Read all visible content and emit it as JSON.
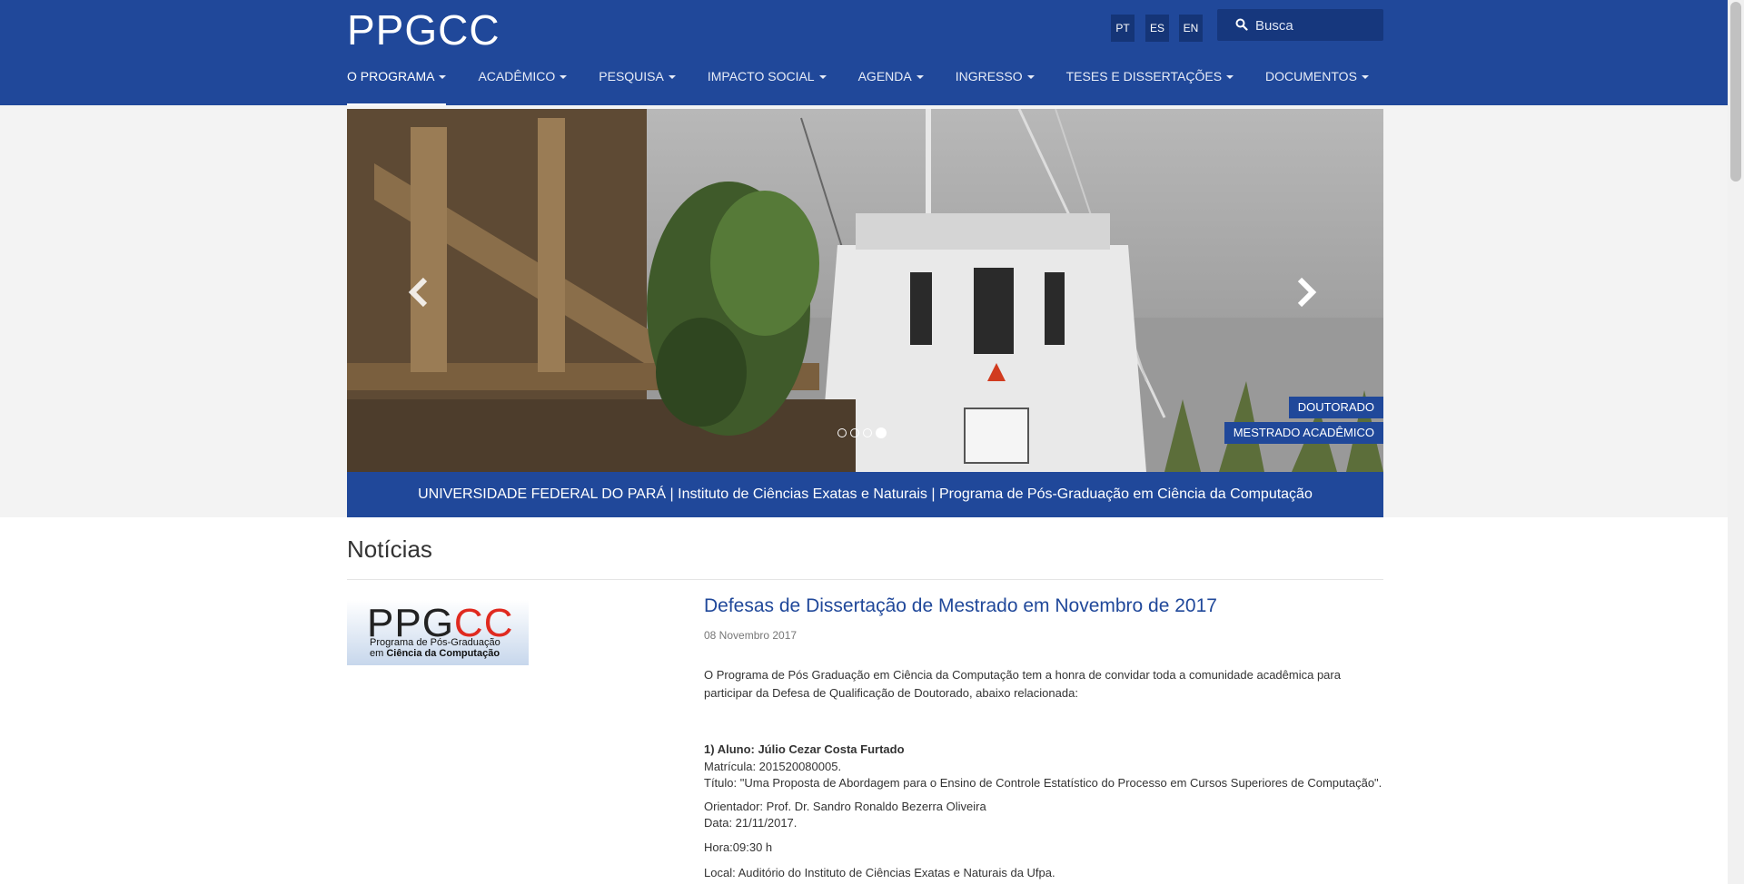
{
  "header": {
    "logo": "PPGCC",
    "languages": [
      "PT",
      "ES",
      "EN"
    ],
    "search_placeholder": "Busca",
    "brand_color": "#20489a"
  },
  "nav": {
    "items": [
      "O PROGRAMA",
      "ACADÊMICO",
      "PESQUISA",
      "IMPACTO SOCIAL",
      "AGENDA",
      "INGRESSO",
      "TESES E DISSERTAÇÕES",
      "DOCUMENTOS"
    ],
    "active_index": 0
  },
  "carousel": {
    "slides": 4,
    "active_slide": 4,
    "tags": [
      "DOUTORADO",
      "MESTRADO ACADÊMICO"
    ],
    "caption": "UNIVERSIDADE FEDERAL DO PARÁ | Instituto de Ciências Exatas e Naturais | Programa de Pós-Graduação em Ciência da Computação"
  },
  "news": {
    "section_title": "Notícias",
    "thumb": {
      "logo_part1": "PPG",
      "logo_part2": "CC",
      "line1": "Programa de Pós-Graduação",
      "line2_prefix": "em ",
      "line2_bold": "Ciência da Computação"
    },
    "article": {
      "title": "Defesas de Dissertação de Mestrado em Novembro de 2017",
      "date": "08 Novembro 2017",
      "intro": "O Programa de Pós Graduação em Ciência da Computação tem a honra de convidar toda a comunidade acadêmica para participar da Defesa de Qualificação de Doutorado, abaixo relacionada:",
      "student": "1) Aluno: Júlio Cezar Costa Furtado",
      "matricula": "Matrícula: 201520080005.",
      "titulo": "Título: \"Uma Proposta de Abordagem para o Ensino de Controle Estatístico do Processo em Cursos Superiores de Computação\".",
      "orientador": "Orientador: Prof. Dr. Sandro Ronaldo Bezerra Oliveira",
      "data": "Data: 21/11/2017.",
      "hora": "Hora:09:30 h",
      "local": "Local: Auditório  do Instituto de Ciências Exatas e Naturais da Ufpa."
    }
  }
}
